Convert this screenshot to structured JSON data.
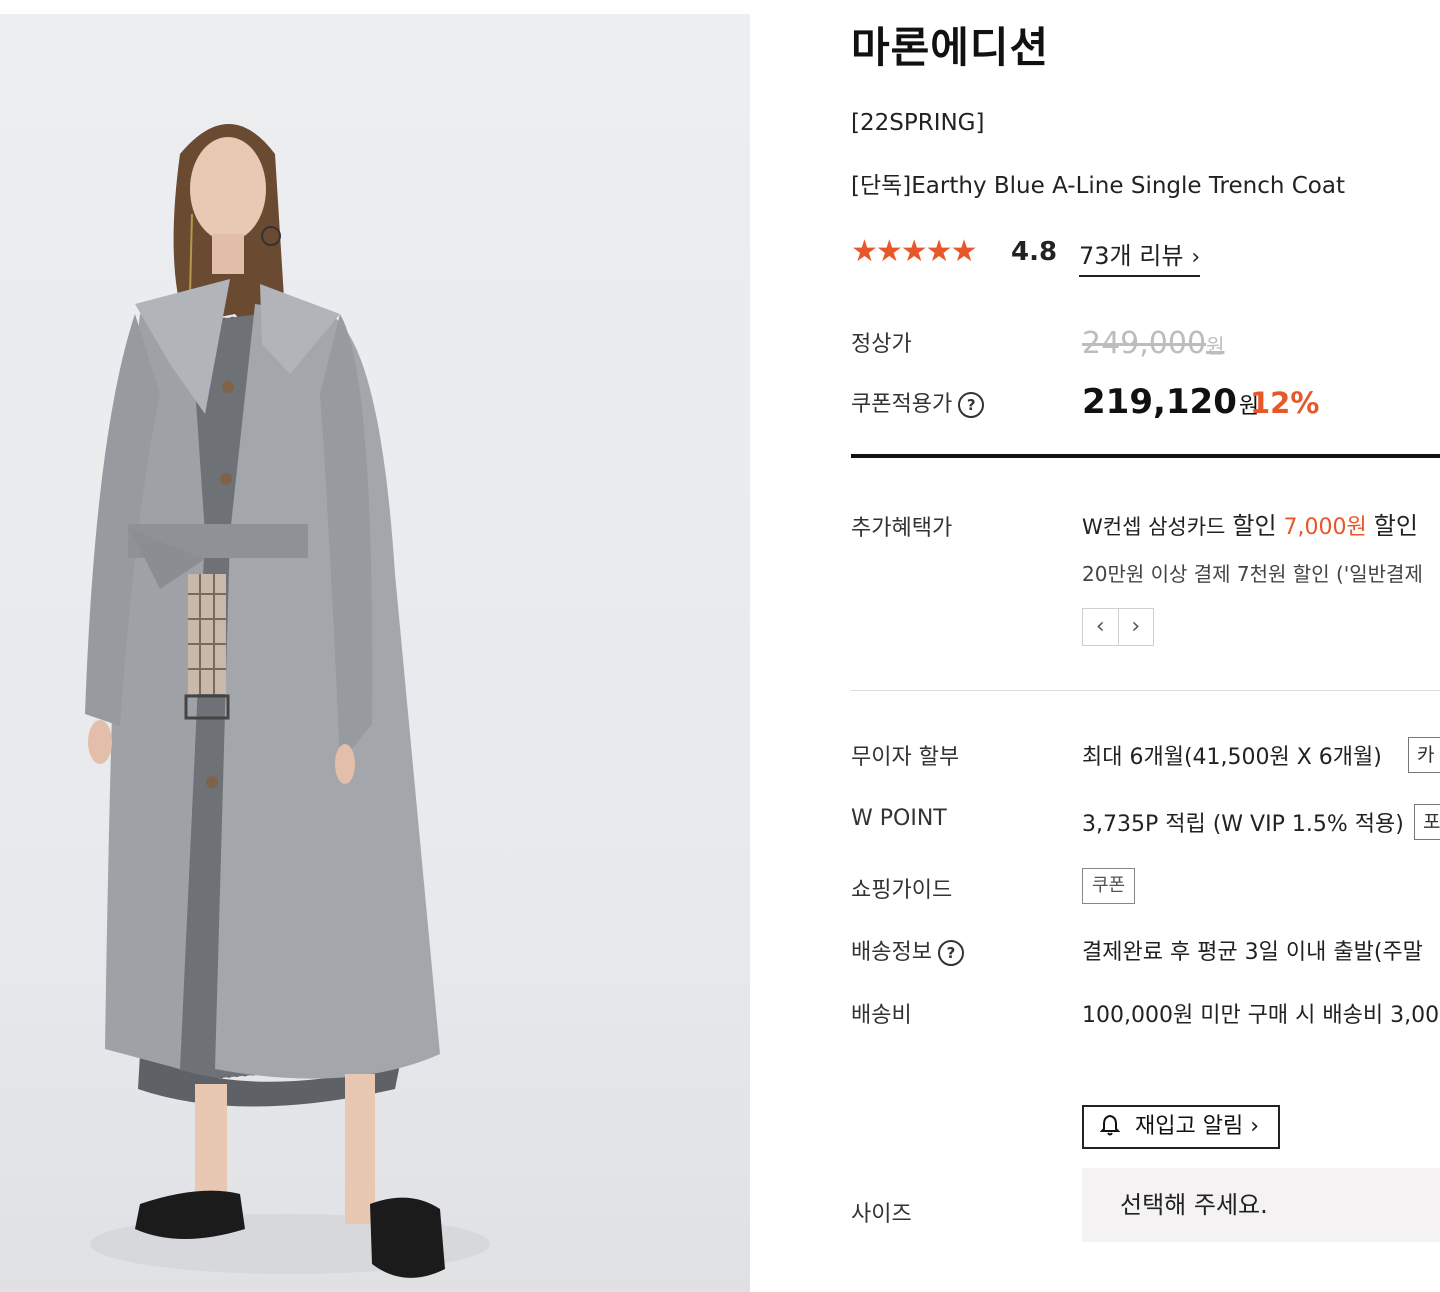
{
  "product": {
    "brand": "마론에디션",
    "season": "[22SPRING]",
    "name": "[단독]Earthy Blue A-Line Single Trench Coat",
    "stars": "★★★★★",
    "rating": "4.8",
    "review_link": "73개 리뷰",
    "review_chevron": "›"
  },
  "price": {
    "regular_label": "정상가",
    "regular_value": "249,000",
    "regular_unit": "원",
    "coupon_label": "쿠폰적용가",
    "coupon_value": "219,120",
    "coupon_unit": "원",
    "discount": "12%"
  },
  "benefit": {
    "label": "추가혜택가",
    "line1_prefix": "W컨셉 삼성카드",
    "line1_word": "할인",
    "line1_amount": "7,000원",
    "line1_suffix": "할인",
    "line2": "20만원 이상 결제 7천원 할인 ('일반결제",
    "prev": "‹",
    "next": "›"
  },
  "details": {
    "installment_label": "무이자 할부",
    "installment_value": "최대 6개월(41,500원 X 6개월)",
    "installment_btn": "카",
    "point_label": "W POINT",
    "point_value": "3,735P 적립 (W VIP 1.5% 적용)",
    "point_btn": "포",
    "guide_label": "쇼핑가이드",
    "guide_btn": "쿠폰",
    "shipping_label": "배송정보",
    "shipping_value": "결제완료 후 평균 3일 이내 출발(주말",
    "fee_label": "배송비",
    "fee_value": "100,000원 미만 구매 시 배송비 3,00"
  },
  "options": {
    "restock": "재입고 알림",
    "restock_chevron": "›",
    "size_label": "사이즈",
    "size_placeholder": "선택해 주세요."
  },
  "icons": {
    "help": "?",
    "bell": "🔔"
  },
  "colors": {
    "accent": "#e8572a",
    "text": "#222222",
    "strike": "#bdbdbd"
  }
}
